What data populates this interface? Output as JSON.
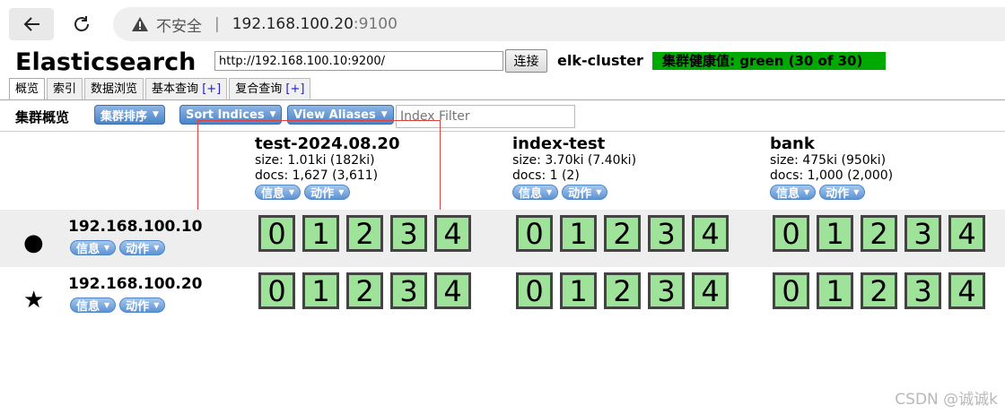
{
  "browser": {
    "insecure_label": "不安全",
    "separator": "|",
    "host": "192.168.100.20",
    "port": ":9100"
  },
  "app": {
    "title": "Elasticsearch",
    "url_value": "http://192.168.100.10:9200/",
    "connect_label": "连接",
    "cluster_name": "elk-cluster",
    "health_text": "集群健康值: green (30 of 30)",
    "health_color": "#00aa00"
  },
  "tabs": [
    {
      "label": "概览"
    },
    {
      "label": "索引"
    },
    {
      "label": "数据浏览"
    },
    {
      "label": "基本查询",
      "plus": "[+]"
    },
    {
      "label": "复合查询",
      "plus": "[+]"
    }
  ],
  "toolbar": {
    "title": "集群概览",
    "sort_cluster": "集群排序",
    "sort_indices": "Sort Indices",
    "view_aliases": "View Aliases",
    "index_filter_placeholder": "Index Filter"
  },
  "pill_labels": {
    "info": "信息",
    "action": "动作"
  },
  "indices": [
    {
      "name": "test-2024.08.20",
      "size": "size: 1.01ki (182ki)",
      "docs": "docs: 1,627 (3,611)"
    },
    {
      "name": "index-test",
      "size": "size: 3.70ki (7.40ki)",
      "docs": "docs: 1 (2)"
    },
    {
      "name": "bank",
      "size": "size: 475ki (950ki)",
      "docs": "docs: 1,000 (2,000)"
    }
  ],
  "nodes": [
    {
      "name": "192.168.100.10",
      "icon": "●",
      "icon_name": "circle-icon"
    },
    {
      "name": "192.168.100.20",
      "icon": "★",
      "icon_name": "star-icon"
    }
  ],
  "shards": [
    "0",
    "1",
    "2",
    "3",
    "4"
  ],
  "watermark": "CSDN @诚诚k"
}
